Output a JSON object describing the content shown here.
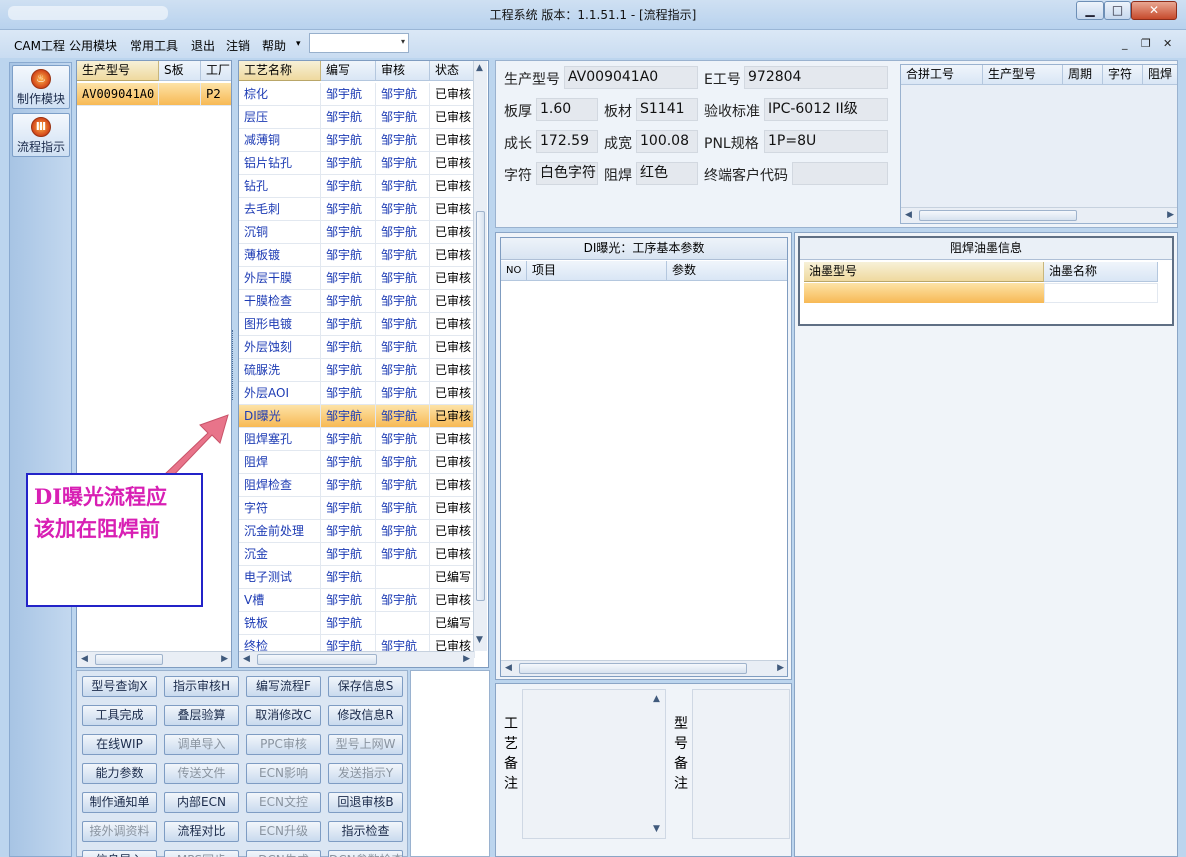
{
  "window": {
    "title": "工程系统   版本：1.1.51.1 - [流程指示]",
    "minimize_glyph": "▁",
    "maximize_glyph": "□",
    "close_glyph": "✕"
  },
  "menu": {
    "items": [
      "CAM工程",
      "公用模块",
      "常用工具",
      "退出",
      "注销",
      "帮助"
    ],
    "help_arrow": "▾",
    "combo_value": "",
    "combo_arrow": "▾",
    "mdi_min": "_",
    "mdi_restore": "❐",
    "mdi_close": "✕"
  },
  "modules": [
    {
      "label": "制作模块",
      "icon": "flame-icon",
      "glyph": "♨"
    },
    {
      "label": "流程指示",
      "icon": "bars-icon",
      "glyph": "Ⅲ"
    }
  ],
  "product_grid": {
    "columns": [
      "生产型号",
      "S板",
      "工厂"
    ],
    "rows": [
      {
        "model": "AV009041A0",
        "s": "",
        "factory": "P2"
      }
    ]
  },
  "process_grid": {
    "columns": [
      "工艺名称",
      "编写",
      "审核",
      "状态"
    ],
    "selected_index": 14,
    "rows": [
      {
        "name": "棕化",
        "writer": "邹宇航",
        "reviewer": "邹宇航",
        "status": "已审核"
      },
      {
        "name": "层压",
        "writer": "邹宇航",
        "reviewer": "邹宇航",
        "status": "已审核"
      },
      {
        "name": "减薄铜",
        "writer": "邹宇航",
        "reviewer": "邹宇航",
        "status": "已审核"
      },
      {
        "name": "铝片钻孔",
        "writer": "邹宇航",
        "reviewer": "邹宇航",
        "status": "已审核"
      },
      {
        "name": "钻孔",
        "writer": "邹宇航",
        "reviewer": "邹宇航",
        "status": "已审核"
      },
      {
        "name": "去毛刺",
        "writer": "邹宇航",
        "reviewer": "邹宇航",
        "status": "已审核"
      },
      {
        "name": "沉铜",
        "writer": "邹宇航",
        "reviewer": "邹宇航",
        "status": "已审核"
      },
      {
        "name": "薄板镀",
        "writer": "邹宇航",
        "reviewer": "邹宇航",
        "status": "已审核"
      },
      {
        "name": "外层干膜",
        "writer": "邹宇航",
        "reviewer": "邹宇航",
        "status": "已审核"
      },
      {
        "name": "干膜检查",
        "writer": "邹宇航",
        "reviewer": "邹宇航",
        "status": "已审核"
      },
      {
        "name": "图形电镀",
        "writer": "邹宇航",
        "reviewer": "邹宇航",
        "status": "已审核"
      },
      {
        "name": "外层蚀刻",
        "writer": "邹宇航",
        "reviewer": "邹宇航",
        "status": "已审核"
      },
      {
        "name": "硫脲洗",
        "writer": "邹宇航",
        "reviewer": "邹宇航",
        "status": "已审核"
      },
      {
        "name": "外层AOI",
        "writer": "邹宇航",
        "reviewer": "邹宇航",
        "status": "已审核"
      },
      {
        "name": "DI曝光",
        "writer": "邹宇航",
        "reviewer": "邹宇航",
        "status": "已审核"
      },
      {
        "name": "阻焊塞孔",
        "writer": "邹宇航",
        "reviewer": "邹宇航",
        "status": "已审核"
      },
      {
        "name": "阻焊",
        "writer": "邹宇航",
        "reviewer": "邹宇航",
        "status": "已审核"
      },
      {
        "name": "阻焊检查",
        "writer": "邹宇航",
        "reviewer": "邹宇航",
        "status": "已审核"
      },
      {
        "name": "字符",
        "writer": "邹宇航",
        "reviewer": "邹宇航",
        "status": "已审核"
      },
      {
        "name": "沉金前处理",
        "writer": "邹宇航",
        "reviewer": "邹宇航",
        "status": "已审核"
      },
      {
        "name": "沉金",
        "writer": "邹宇航",
        "reviewer": "邹宇航",
        "status": "已审核"
      },
      {
        "name": "电子测试",
        "writer": "邹宇航",
        "reviewer": "",
        "status": "已编写"
      },
      {
        "name": "V槽",
        "writer": "邹宇航",
        "reviewer": "邹宇航",
        "status": "已审核"
      },
      {
        "name": "铣板",
        "writer": "邹宇航",
        "reviewer": "",
        "status": "已编写"
      },
      {
        "name": "终检",
        "writer": "邹宇航",
        "reviewer": "邹宇航",
        "status": "已审核"
      }
    ]
  },
  "info": {
    "model_label": "生产型号",
    "model": "AV009041A0",
    "eno_label": "E工号",
    "eno": "972804",
    "thickness_label": "板厚",
    "thickness": "1.60",
    "material_label": "板材",
    "material": "S1141",
    "standard_label": "验收标准",
    "standard": "IPC-6012 II级",
    "length_label": "成长",
    "length": "172.59",
    "width_label": "成宽",
    "width": "100.08",
    "pnl_label": "PNL规格",
    "pnl": "1P=8U",
    "char_label": "字符",
    "char": "白色字符",
    "mask_label": "阻焊",
    "mask": "红色",
    "customer_label": "终端客户代码",
    "customer": ""
  },
  "combine_grid": {
    "columns": [
      "合拼工号",
      "生产型号",
      "周期",
      "字符",
      "阻焊"
    ]
  },
  "process_params": {
    "title": "DI曝光：工序基本参数",
    "columns": [
      "NO",
      "项目",
      "参数"
    ]
  },
  "ink_panel": {
    "title": "阻焊油墨信息",
    "columns": [
      "油墨型号",
      "油墨名称"
    ]
  },
  "remarks": {
    "process_label": "工艺备注",
    "model_label": "型号备注"
  },
  "buttons": [
    [
      "型号查询X",
      "指示审核H",
      "编写流程F",
      "保存信息S"
    ],
    [
      "工具完成",
      "叠层验算",
      "取消修改C",
      "修改信息R"
    ],
    [
      "在线WIP",
      "调单导入",
      "PPC审核",
      "型号上网W"
    ],
    [
      "能力参数",
      "传送文件",
      "ECN影响",
      "发送指示Y"
    ],
    [
      "制作通知单",
      "内部ECN",
      "ECN文控",
      "回退审核B"
    ],
    [
      "接外调资料",
      "流程对比",
      "ECN升级",
      "指示检查"
    ],
    [
      "信息导入",
      "MPS同步",
      "DCN生成",
      "DCN参数检查"
    ]
  ],
  "annotation": {
    "line1": "DI曝光流程应",
    "line2": "该加在阻焊前",
    "arrow_color": "#e8748a",
    "text_color": "#d81fb4"
  }
}
